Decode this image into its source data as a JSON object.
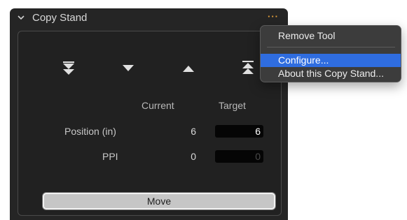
{
  "panel": {
    "title": "Copy Stand",
    "more_label": "···",
    "columns": {
      "current": "Current",
      "target": "Target"
    },
    "rows": [
      {
        "label": "Position (in)",
        "current": "6",
        "target": "6"
      },
      {
        "label": "PPI",
        "current": "0",
        "target": "0"
      }
    ],
    "move_label": "Move",
    "arrow_icons": [
      "double-down-arrow-icon",
      "down-arrow-icon",
      "up-arrow-icon",
      "double-up-arrow-icon"
    ]
  },
  "menu": {
    "items": [
      {
        "label": "Remove Tool"
      },
      {
        "label": "Configure..."
      },
      {
        "label": "About this Copy Stand..."
      }
    ],
    "selected": "Configure..."
  },
  "colors": {
    "accent": "#e8a23a",
    "selection": "#2f6de0",
    "panel_bg": "#252525"
  }
}
